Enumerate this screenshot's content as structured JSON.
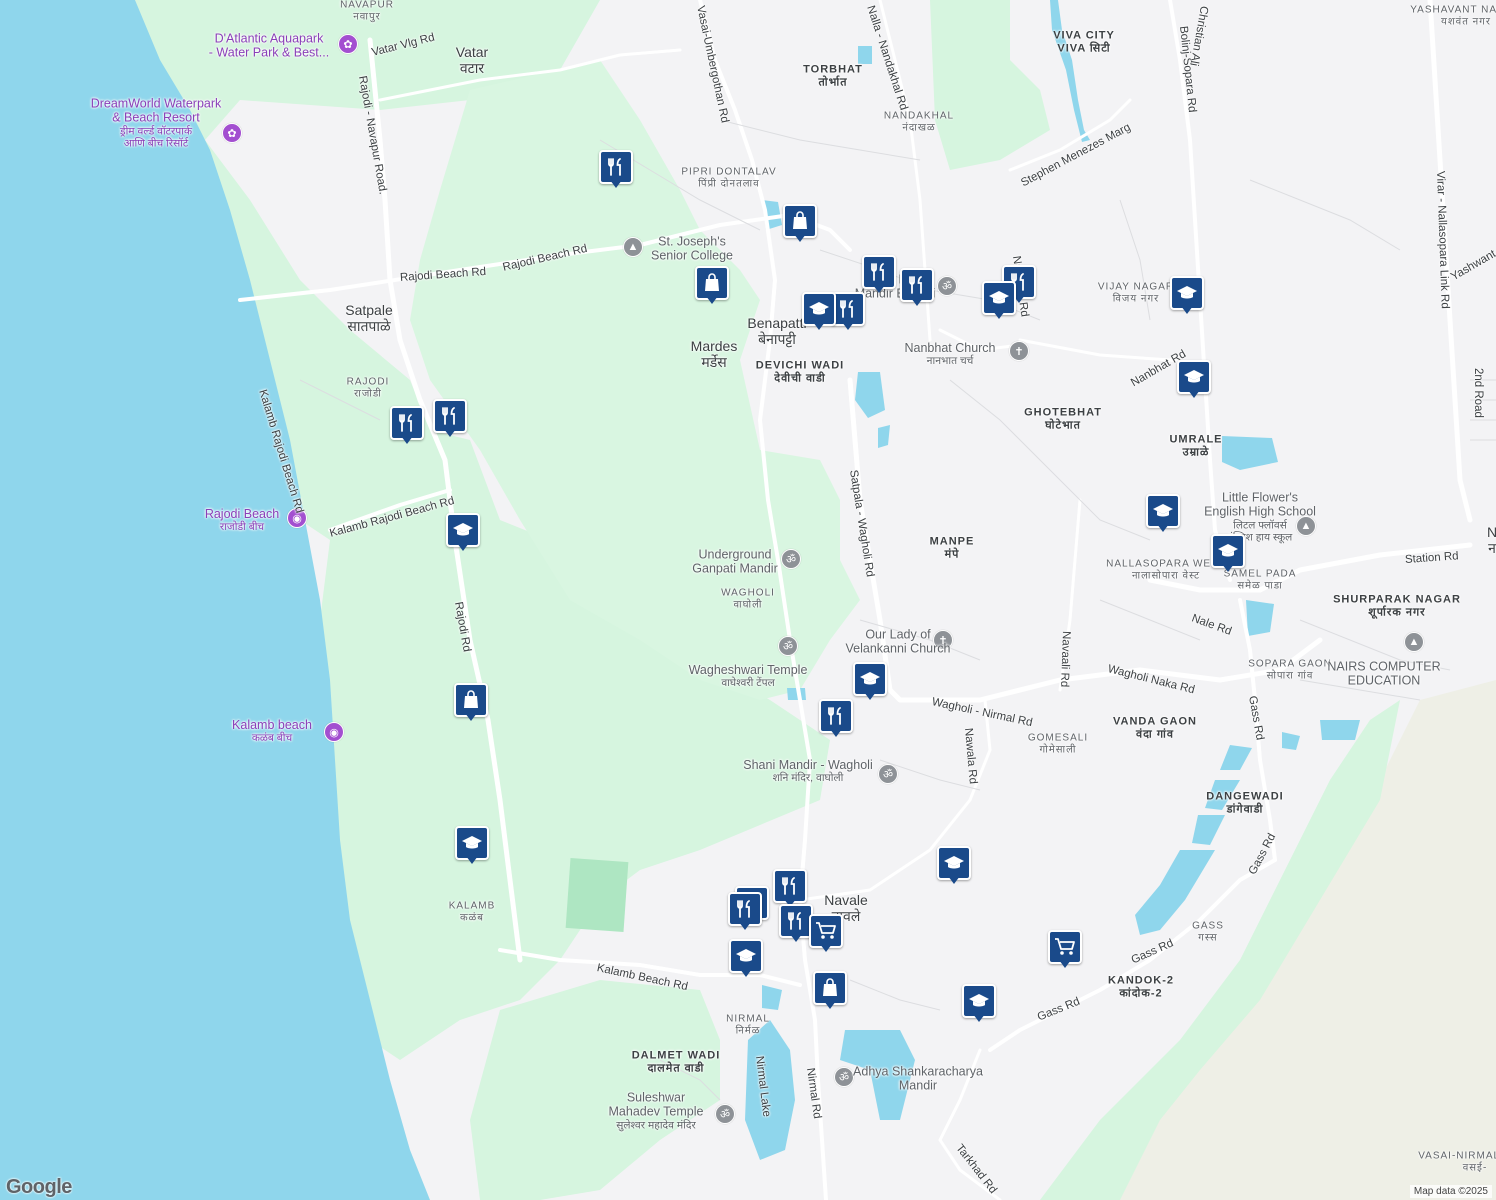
{
  "map": {
    "places": [
      {
        "id": "navapur",
        "en": "NAVAPUR",
        "mr": "नवापुर",
        "kind": "small"
      },
      {
        "id": "vatar",
        "en": "Vatar",
        "mr": "वटार",
        "kind": "place"
      },
      {
        "id": "torbhat",
        "en": "TORBHAT",
        "mr": "तोर्भात",
        "kind": "area"
      },
      {
        "id": "viva-city",
        "en": "VIVA CITY",
        "mr": "VIVA सिटी",
        "kind": "area"
      },
      {
        "id": "yashavant-nagar",
        "en": "YASHAVANT NAGAR",
        "mr": "यशवंत नगर",
        "kind": "small"
      },
      {
        "id": "nandakhal",
        "en": "NANDAKHAL",
        "mr": "नंदाखळ",
        "kind": "small"
      },
      {
        "id": "pipri-dontalav",
        "en": "PIPRI DONTALAV",
        "mr": "पिंप्री दोनतलाव",
        "kind": "small"
      },
      {
        "id": "satpale",
        "en": "Satpale",
        "mr": "सातपाळे",
        "kind": "place"
      },
      {
        "id": "rajodi",
        "en": "RAJODI",
        "mr": "राजोडी",
        "kind": "small"
      },
      {
        "id": "mardes",
        "en": "Mardes",
        "mr": "मर्डेस",
        "kind": "place"
      },
      {
        "id": "benapatti",
        "en": "Benapatti",
        "mr": "बेनापट्टी",
        "kind": "place"
      },
      {
        "id": "devichi-wadi",
        "en": "DEVICHI WADI",
        "mr": "देवीची वाडी",
        "kind": "area"
      },
      {
        "id": "vijay-nagar",
        "en": "VIJAY NAGAR",
        "mr": "विजय नगर",
        "kind": "small"
      },
      {
        "id": "ghotebhat",
        "en": "GHOTEBHAT",
        "mr": "घोटेभात",
        "kind": "area"
      },
      {
        "id": "umrale",
        "en": "UMRALE",
        "mr": "उम्राळे",
        "kind": "area"
      },
      {
        "id": "manpe",
        "en": "MANPE",
        "mr": "मंपे",
        "kind": "area"
      },
      {
        "id": "nallasopara-west",
        "en": "NALLASOPARA WEST",
        "mr": "नालासोपारा वेस्ट",
        "kind": "small"
      },
      {
        "id": "samel-pada",
        "en": "SAMEL PADA",
        "mr": "समेळ पाडा",
        "kind": "small"
      },
      {
        "id": "shurparak-nagar",
        "en": "SHURPARAK NAGAR",
        "mr": "शूर्पारक नगर",
        "kind": "area"
      },
      {
        "id": "sopara-gaon",
        "en": "SOPARA GAON",
        "mr": "सोपारा गांव",
        "kind": "small"
      },
      {
        "id": "wagholi",
        "en": "WAGHOLI",
        "mr": "वाघोली",
        "kind": "small"
      },
      {
        "id": "vanda-gaon",
        "en": "VANDA GAON",
        "mr": "वंदा गांव",
        "kind": "area"
      },
      {
        "id": "gomesali",
        "en": "GOMESALI",
        "mr": "गोमेसाली",
        "kind": "small"
      },
      {
        "id": "dangewadi",
        "en": "DANGEWADI",
        "mr": "डांगेवाडी",
        "kind": "area"
      },
      {
        "id": "navale",
        "en": "Navale",
        "mr": "नावले",
        "kind": "place"
      },
      {
        "id": "kalamb",
        "en": "KALAMB",
        "mr": "कळंब",
        "kind": "small"
      },
      {
        "id": "gass",
        "en": "GASS",
        "mr": "गस्स",
        "kind": "small"
      },
      {
        "id": "kandok-2",
        "en": "KANDOK-2",
        "mr": "कांदोक-2",
        "kind": "area"
      },
      {
        "id": "nirmal",
        "en": "NIRMAL",
        "mr": "निर्मळ",
        "kind": "small"
      },
      {
        "id": "dalmet-wadi",
        "en": "DALMET WADI",
        "mr": "दालमेत वाडी",
        "kind": "area"
      },
      {
        "id": "vasai-nirmal-salt",
        "en": "VASAI-NIRMAL SALT",
        "mr": "वसई-",
        "kind": "small"
      },
      {
        "id": "n-edge",
        "en": "N",
        "mr": "न",
        "kind": "place"
      }
    ],
    "pois": [
      {
        "id": "datlantic",
        "text": "D'Atlantic Aquapark\n- Water Park & Best...",
        "color": "purple",
        "icon": "amusement-icon"
      },
      {
        "id": "dreamworld",
        "text": "DreamWorld Waterpark\n& Beach Resort",
        "mr": "ड्रीम वर्ल्ड वॉटरपार्क\nआणि बीच रिसॉर्ट",
        "color": "purple",
        "icon": "amusement-icon"
      },
      {
        "id": "st-josephs",
        "text": "St. Joseph's\nSenior College",
        "color": "grey",
        "icon": "school-icon"
      },
      {
        "id": "shree-datta",
        "text": "Shree Datta\nMandir Badhai",
        "color": "grey",
        "icon": "temple-icon"
      },
      {
        "id": "nanbhat-church",
        "text": "Nanbhat Church",
        "mr": "नानभात चर्च",
        "color": "grey",
        "icon": "church-icon"
      },
      {
        "id": "little-flowers",
        "text": "Little Flower's\nEnglish High School",
        "mr": "लिटल फ्लॉवर्स\nइंग्लिश हाय स्कूल",
        "color": "grey",
        "icon": "school-icon"
      },
      {
        "id": "rajodi-beach",
        "text": "Rajodi Beach",
        "mr": "राजोडी बीच",
        "color": "purple",
        "icon": "camera-icon"
      },
      {
        "id": "underground-ganpati",
        "text": "Underground\nGanpati Mandir",
        "color": "grey",
        "icon": "temple-icon"
      },
      {
        "id": "our-lady",
        "text": "Our Lady of\nVelankanni Church",
        "color": "grey",
        "icon": "church-icon"
      },
      {
        "id": "nairs",
        "text": "NAIRS COMPUTER\nEDUCATION",
        "color": "grey",
        "icon": "school-icon"
      },
      {
        "id": "wagheshwari",
        "text": "Wagheshwari Temple",
        "mr": "वाघेश्वरी टेंपल",
        "color": "grey",
        "icon": "temple-icon"
      },
      {
        "id": "kalamb-beach",
        "text": "Kalamb beach",
        "mr": "कळंब बीच",
        "color": "purple",
        "icon": "camera-icon"
      },
      {
        "id": "shani-mandir",
        "text": "Shani Mandir - Wagholi",
        "mr": "शनि मंदिर, वाघोली",
        "color": "grey",
        "icon": "temple-icon"
      },
      {
        "id": "adhya",
        "text": "Adhya Shankaracharya\nMandir",
        "color": "grey",
        "icon": "temple-icon"
      },
      {
        "id": "suleshwar",
        "text": "Suleshwar\nMahadev Temple",
        "mr": "सुलेश्वर महादेव मंदिर",
        "color": "grey",
        "icon": "temple-icon"
      }
    ],
    "roads": [
      {
        "id": "vatar-vlg",
        "text": "Vatar Vlg Rd"
      },
      {
        "id": "rajodi-navapur",
        "text": "Rajodi - Navapur Road."
      },
      {
        "id": "umbergothan",
        "text": "Vasai-Umbergothan Rd"
      },
      {
        "id": "nalla-nandakhal",
        "text": "Nalla - Nandakhal Rd"
      },
      {
        "id": "stephen-menezes",
        "text": "Stephen Menezes Marg"
      },
      {
        "id": "bolinj-sopara",
        "text": "Bolinj-Sopara Rd"
      },
      {
        "id": "christian",
        "text": "Christian Ali"
      },
      {
        "id": "virar-link",
        "text": "Virar - Nallasopara Link Rd"
      },
      {
        "id": "yashwant",
        "text": "Yashwant"
      },
      {
        "id": "rajodi-beach-1",
        "text": "Rajodi Beach Rd"
      },
      {
        "id": "rajodi-beach-2",
        "text": "Rajodi Beach Rd"
      },
      {
        "id": "nanbhat-rd-1",
        "text": "Nanbhat Rd"
      },
      {
        "id": "nanbhat-rd-2",
        "text": "Nanbhat Rd"
      },
      {
        "id": "2nd-road",
        "text": "2nd Road"
      },
      {
        "id": "kalamb-rajodi-1",
        "text": "Kalamb Rajodi Beach Rd"
      },
      {
        "id": "kalamb-rajodi-2",
        "text": "Kalamb Rajodi Beach Rd"
      },
      {
        "id": "satpala-wagholi",
        "text": "Satpala - Wagholi Rd"
      },
      {
        "id": "station",
        "text": "Station Rd"
      },
      {
        "id": "nale",
        "text": "Nale Rd"
      },
      {
        "id": "rajodi-rd",
        "text": "Rajodi Rd"
      },
      {
        "id": "navaali",
        "text": "Navaali Rd"
      },
      {
        "id": "wagholi-naka",
        "text": "Wagholi Naka Rd"
      },
      {
        "id": "wagholi-nirmal",
        "text": "Wagholi - Nirmal Rd"
      },
      {
        "id": "nawala",
        "text": "Nawala Rd"
      },
      {
        "id": "gass-rd-1",
        "text": "Gass Rd"
      },
      {
        "id": "gass-rd-2",
        "text": "Gass Rd"
      },
      {
        "id": "gass-rd-3",
        "text": "Gass Rd"
      },
      {
        "id": "gass-rd-4",
        "text": "Gass Rd"
      },
      {
        "id": "kalamb-beach-rd",
        "text": "Kalamb Beach Rd"
      },
      {
        "id": "nirmal-lake",
        "text": "Nirmal Lake"
      },
      {
        "id": "nirmal-rd",
        "text": "Nirmal Rd"
      },
      {
        "id": "tarkhad",
        "text": "Tarkhad Rd"
      }
    ],
    "markers": [
      "restaurant",
      "restaurant",
      "restaurant",
      "restaurant",
      "restaurant",
      "restaurant",
      "restaurant",
      "restaurant",
      "restaurant",
      "restaurant",
      "restaurant",
      "restaurant",
      "school",
      "school",
      "school",
      "school",
      "school",
      "school",
      "school",
      "school",
      "school",
      "school",
      "school",
      "school",
      "shopping",
      "shopping",
      "shopping",
      "grocery",
      "grocery"
    ],
    "colors": {
      "water": "#8fd6ec",
      "green": "#d6f5df",
      "land": "#f3f3f5",
      "road": "#ffffff",
      "marker": "#1a4a8a",
      "poi_purple": "#a34fd0",
      "poi_grey": "#8e9297"
    },
    "logo": "Google",
    "credit": "Map data ©2025"
  }
}
